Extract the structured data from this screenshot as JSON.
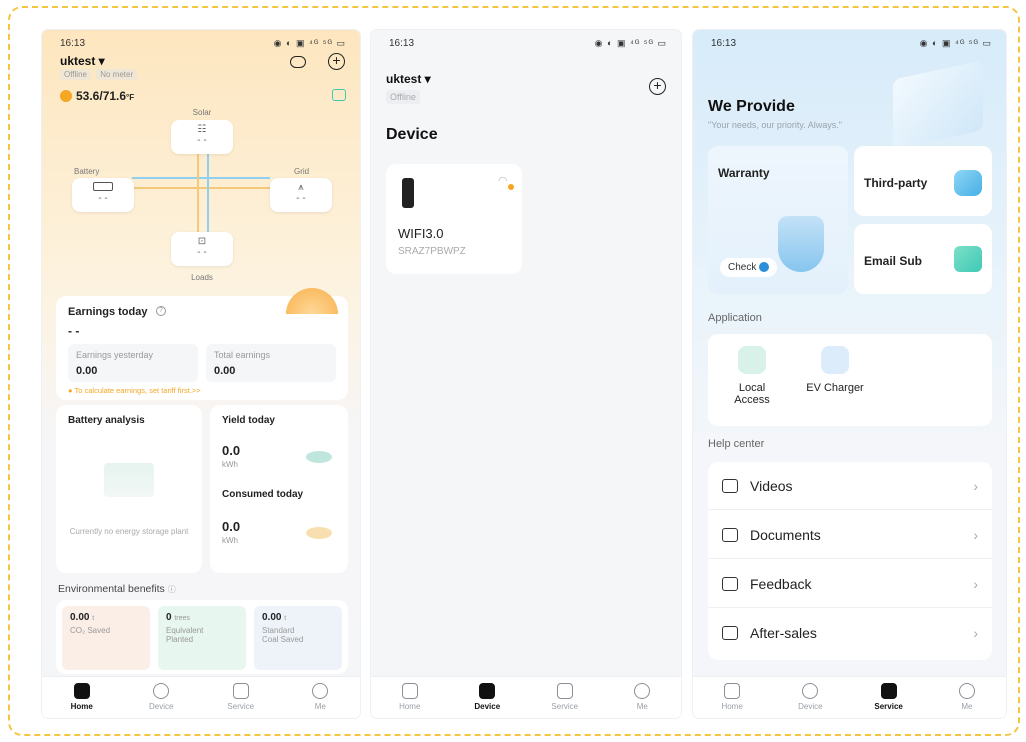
{
  "colors": {
    "accent_orange": "#f5a623",
    "frame_dash": "#f5c542",
    "teal": "#3ec9b5",
    "blue_icon": "#3fa1e8"
  },
  "status_bar": {
    "time": "16:13",
    "icons_text": "◉ ◐ ▣ ⁴ᴳ ⁵ᴳ ▭"
  },
  "tabs": [
    {
      "label": "Home",
      "icon": "home-icon"
    },
    {
      "label": "Device",
      "icon": "device-icon"
    },
    {
      "label": "Service",
      "icon": "service-icon"
    },
    {
      "label": "Me",
      "icon": "me-icon"
    }
  ],
  "home": {
    "plant_name": "uktest ▾",
    "status_offline": "Offline",
    "status_meter": "No meter",
    "weather": "53.6/71.6",
    "weather_unit": "°F",
    "flow": {
      "solar_label": "Solar",
      "solar_value": "- -",
      "battery_label": "Battery",
      "battery_value": "- -",
      "grid_label": "Grid",
      "grid_value": "- -",
      "loads_label": "Loads",
      "loads_value": "- -"
    },
    "earnings": {
      "title": "Earnings today",
      "today_value": "- -",
      "yesterday_label": "Earnings yesterday",
      "yesterday_value": "0.00",
      "total_label": "Total earnings",
      "total_value": "0.00",
      "tip": "To calculate earnings, set tariff first.>>"
    },
    "battery_analysis": {
      "title": "Battery analysis",
      "empty_text": "Currently no energy storage plant"
    },
    "yield": {
      "title": "Yield today",
      "value": "0.0",
      "unit": "kWh"
    },
    "consumed": {
      "title": "Consumed today",
      "value": "0.0",
      "unit": "kWh"
    },
    "environment": {
      "title": "Environmental benefits",
      "co2_value": "0.00",
      "co2_unit": "t",
      "co2_label": "CO₂ Saved",
      "trees_value": "0",
      "trees_unit": "trees",
      "trees_label": "Equivalent Planted",
      "coal_value": "0.00",
      "coal_unit": "t",
      "coal_label": "Standard Coal Saved"
    }
  },
  "device": {
    "plant_name": "uktest ▾",
    "status_offline": "Offline",
    "page_title": "Device",
    "card": {
      "name": "WIFI3.0",
      "serial": "SRAZ7PBWPZ"
    }
  },
  "service": {
    "title": "We Provide",
    "subtitle": "\"Your needs, our priority. Always.\"",
    "warranty": "Warranty",
    "check": "Check",
    "third_party": "Third-party",
    "email_sub": "Email Sub",
    "application_header": "Application",
    "apps": [
      {
        "label": "Local Access"
      },
      {
        "label": "EV Charger"
      }
    ],
    "help_header": "Help center",
    "help_items": [
      {
        "label": "Videos"
      },
      {
        "label": "Documents"
      },
      {
        "label": "Feedback"
      },
      {
        "label": "After-sales"
      }
    ]
  }
}
